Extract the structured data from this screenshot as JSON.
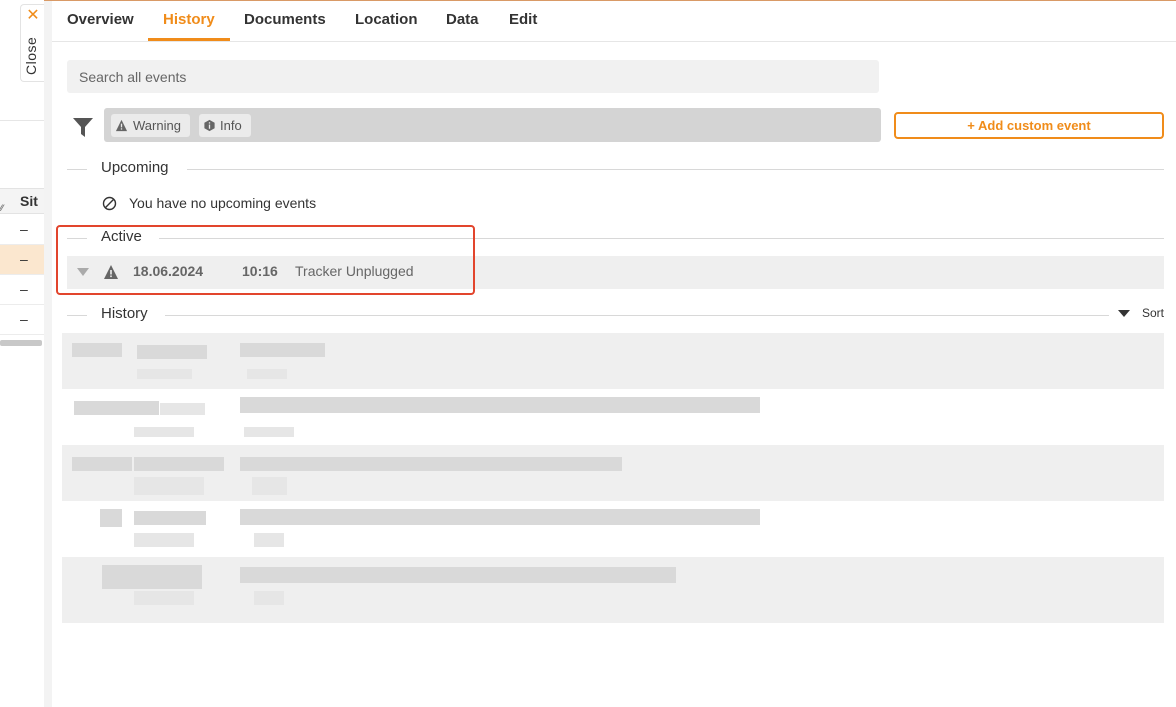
{
  "background": {
    "column_header": "Sit",
    "rows": [
      "–",
      "–",
      "–",
      "–"
    ],
    "highlighted_row_index": 1
  },
  "close_tab": {
    "label": "Close",
    "icon": "close-icon"
  },
  "tabs": [
    {
      "label": "Overview",
      "active": false
    },
    {
      "label": "History",
      "active": true
    },
    {
      "label": "Documents",
      "active": false
    },
    {
      "label": "Location",
      "active": false
    },
    {
      "label": "Data",
      "active": false
    },
    {
      "label": "Edit",
      "active": false
    }
  ],
  "search": {
    "placeholder": "Search all events"
  },
  "filters": {
    "icon": "funnel-icon",
    "chips": [
      {
        "label": "Warning",
        "icon": "warning-icon"
      },
      {
        "label": "Info",
        "icon": "info-icon"
      }
    ]
  },
  "add_custom_event": {
    "label": "+ Add custom event"
  },
  "sections": {
    "upcoming": {
      "label": "Upcoming",
      "empty_text": "You have no upcoming events",
      "empty_icon": "ban-icon"
    },
    "active": {
      "label": "Active",
      "events": [
        {
          "date": "18.06.2024",
          "time": "10:16",
          "description": "Tracker Unplugged",
          "icon": "warning-icon"
        }
      ]
    },
    "history": {
      "label": "History",
      "sort_label": "Sort"
    }
  },
  "colors": {
    "accent": "#f08c1a",
    "highlight_border": "#e2452d"
  }
}
